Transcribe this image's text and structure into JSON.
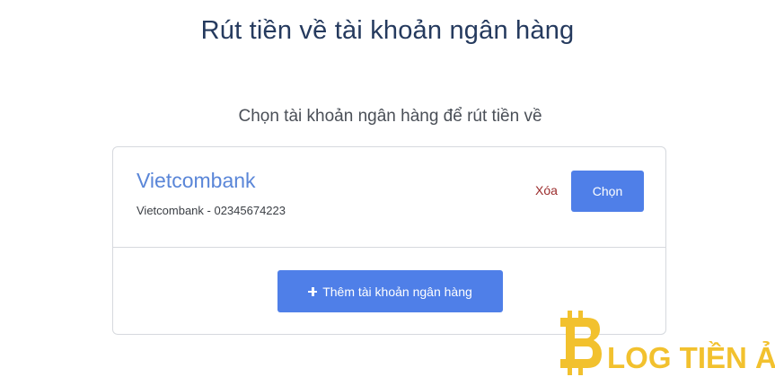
{
  "page": {
    "title": "Rút tiền về tài khoản ngân hàng",
    "subtitle": "Chọn tài khoản ngân hàng để rút tiền về"
  },
  "account": {
    "bank_name": "Vietcombank",
    "detail": "Vietcombank - 02345674223",
    "delete_label": "Xóa",
    "choose_label": "Chọn"
  },
  "add_account": {
    "label": "Thêm tài khoản ngân hàng",
    "icon": "plus-icon"
  },
  "watermark": {
    "text": "LOG TIỀN ẢO",
    "logo_icon": "bitcoin-b-icon"
  },
  "colors": {
    "title": "#253a5e",
    "accent": "#4f7fe8",
    "bank_name": "#5a86d8",
    "delete": "#9b2c2c",
    "watermark_gold": "#f2c12e"
  }
}
